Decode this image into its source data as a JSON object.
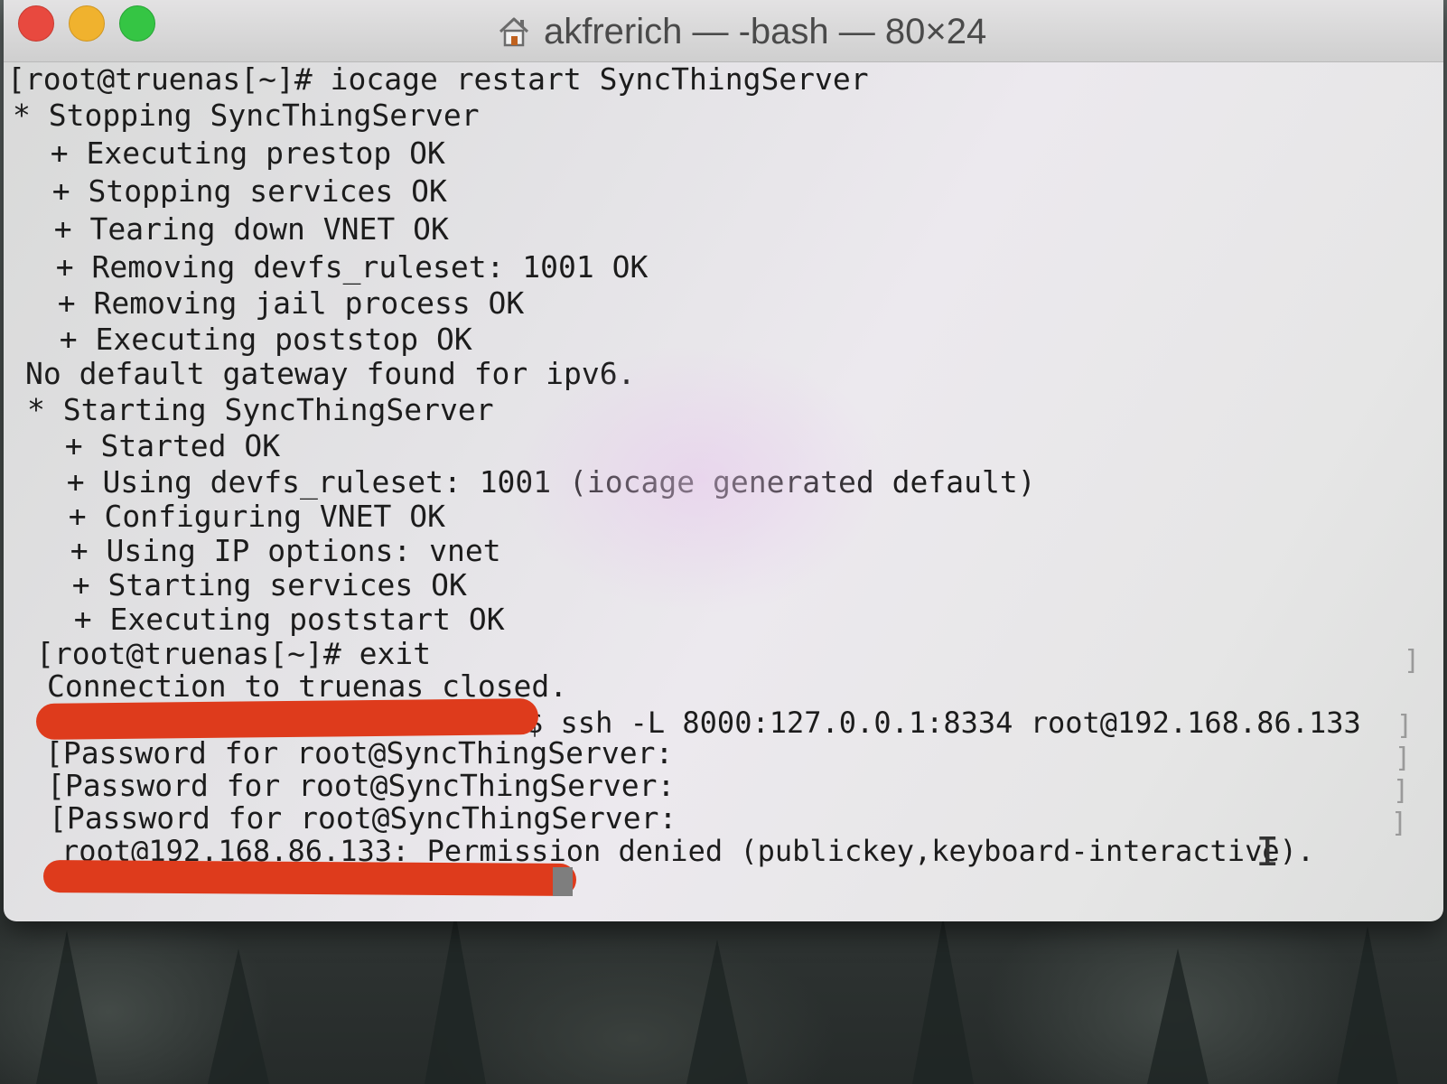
{
  "window": {
    "title": "akfrerich — -bash — 80×24",
    "controls": [
      "close",
      "minimize",
      "zoom"
    ],
    "title_icon": "home-icon"
  },
  "terminal": {
    "lines": [
      "[root@truenas[~]# iocage restart SyncThingServer",
      "* Stopping SyncThingServer",
      "  + Executing prestop OK",
      "  + Stopping services OK",
      "  + Tearing down VNET OK",
      "  + Removing devfs_ruleset: 1001 OK",
      "  + Removing jail process OK",
      "  + Executing poststop OK",
      "No default gateway found for ipv6.",
      "* Starting SyncThingServer",
      "  + Started OK",
      "  + Using devfs_ruleset: 1001 (iocage generated default)",
      "  + Configuring VNET OK",
      "  + Using IP options: vnet",
      "  + Starting services OK",
      "  + Executing poststart OK",
      "[root@truenas[~]# exit",
      "Connection to truenas closed.",
      "$ ssh -L 8000:127.0.0.1:8334 root@192.168.86.133",
      "[Password for root@SyncThingServer:",
      "[Password for root@SyncThingServer:",
      "[Password for root@SyncThingServer:",
      "root@192.168.86.133: Permission denied (publickey,keyboard-interactive)."
    ],
    "mark_char": "]",
    "redaction_color": "#de3b1c"
  }
}
